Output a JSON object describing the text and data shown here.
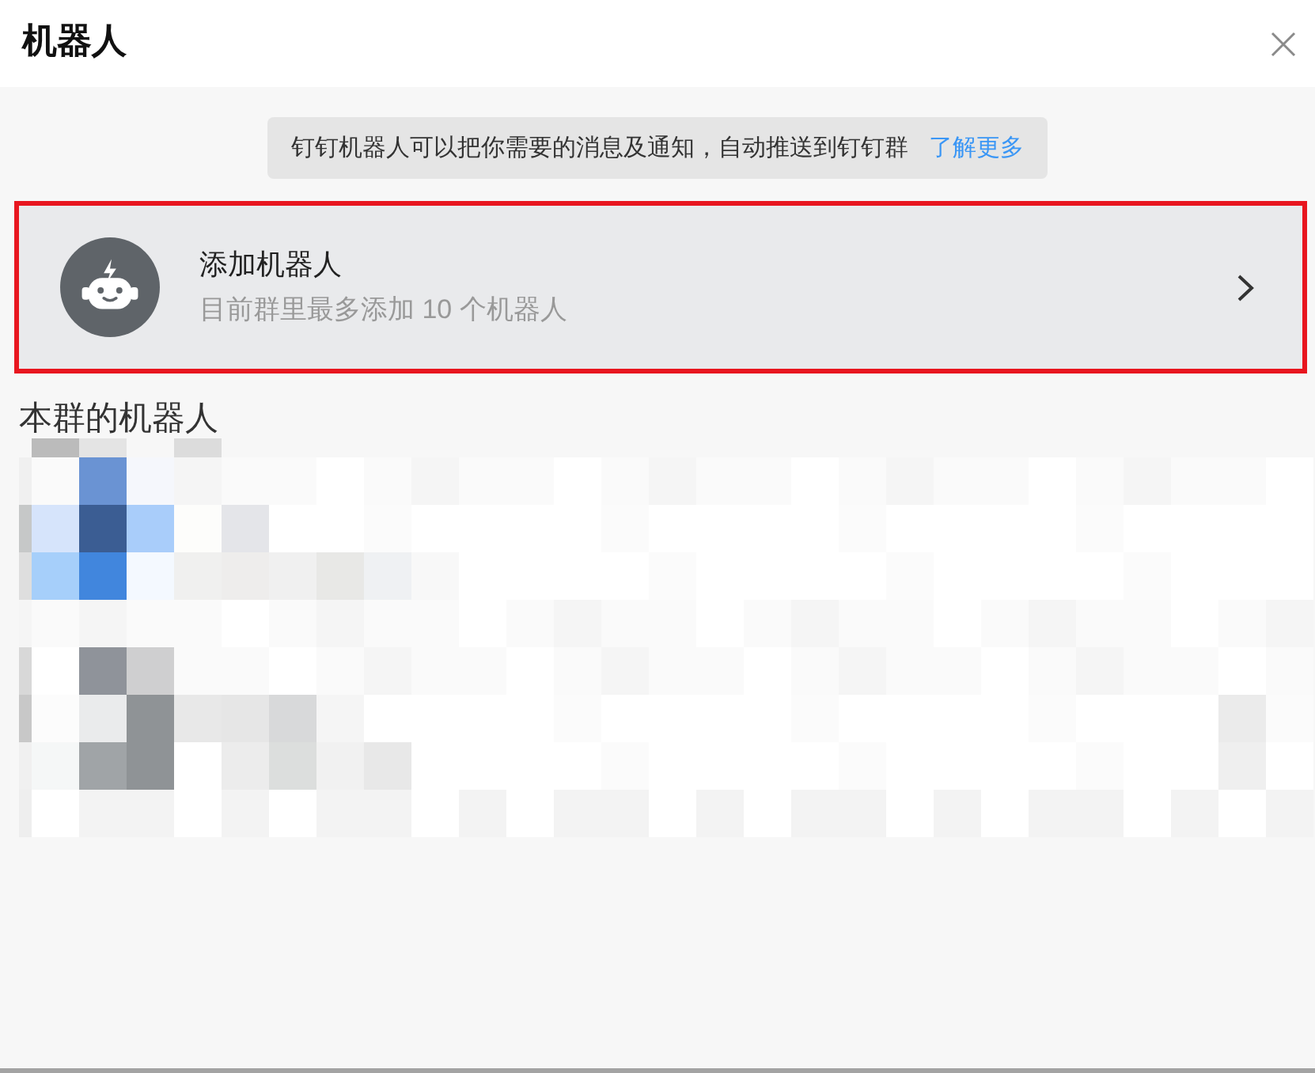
{
  "dialog": {
    "title": "机器人"
  },
  "notice": {
    "text": "钉钉机器人可以把你需要的消息及通知，自动推送到钉钉群",
    "link": "了解更多"
  },
  "add_robot": {
    "title": "添加机器人",
    "subtitle": "目前群里最多添加 10 个机器人",
    "highlighted": true
  },
  "group_robots": {
    "heading": "本群的机器人"
  }
}
